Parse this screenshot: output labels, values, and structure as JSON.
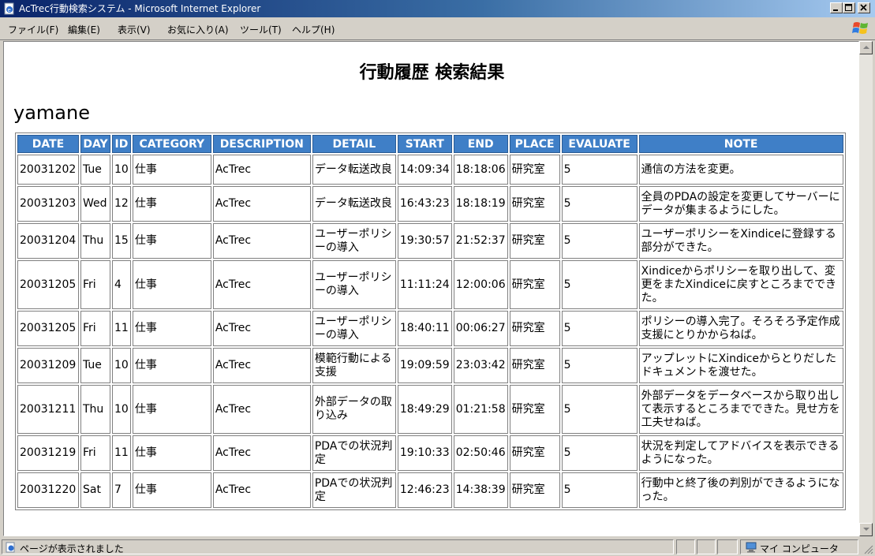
{
  "window": {
    "title": "AcTrec行動検索システム - Microsoft Internet Explorer"
  },
  "menu": {
    "items": [
      "ファイル(F)",
      "編集(E)",
      "表示(V)",
      "お気に入り(A)",
      "ツール(T)",
      "ヘルプ(H)"
    ]
  },
  "page": {
    "title": "行動履歴 検索結果",
    "user": "yamane"
  },
  "table": {
    "headers": [
      "DATE",
      "DAY",
      "ID",
      "CATEGORY",
      "DESCRIPTION",
      "DETAIL",
      "START",
      "END",
      "PLACE",
      "EVALUATE",
      "NOTE"
    ],
    "rows": [
      [
        "20031202",
        "Tue",
        "10",
        "仕事",
        "AcTrec",
        "データ転送改良",
        "14:09:34",
        "18:18:06",
        "研究室",
        "5",
        "通信の方法を変更。"
      ],
      [
        "20031203",
        "Wed",
        "12",
        "仕事",
        "AcTrec",
        "データ転送改良",
        "16:43:23",
        "18:18:19",
        "研究室",
        "5",
        "全員のPDAの設定を変更してサーバーにデータが集まるようにした。"
      ],
      [
        "20031204",
        "Thu",
        "15",
        "仕事",
        "AcTrec",
        "ユーザーポリシーの導入",
        "19:30:57",
        "21:52:37",
        "研究室",
        "5",
        "ユーザーポリシーをXindiceに登録する部分ができた。"
      ],
      [
        "20031205",
        "Fri",
        "4",
        "仕事",
        "AcTrec",
        "ユーザーポリシーの導入",
        "11:11:24",
        "12:00:06",
        "研究室",
        "5",
        "Xindiceからポリシーを取り出して、変更をまたXindiceに戻すところまでできた。"
      ],
      [
        "20031205",
        "Fri",
        "11",
        "仕事",
        "AcTrec",
        "ユーザーポリシーの導入",
        "18:40:11",
        "00:06:27",
        "研究室",
        "5",
        "ポリシーの導入完了。そろそろ予定作成支援にとりかからねば。"
      ],
      [
        "20031209",
        "Tue",
        "10",
        "仕事",
        "AcTrec",
        "模範行動による支援",
        "19:09:59",
        "23:03:42",
        "研究室",
        "5",
        "アップレットにXindiceからとりだしたドキュメントを渡せた。"
      ],
      [
        "20031211",
        "Thu",
        "10",
        "仕事",
        "AcTrec",
        "外部データの取り込み",
        "18:49:29",
        "01:21:58",
        "研究室",
        "5",
        "外部データをデータベースから取り出して表示するところまでできた。見せ方を工夫せねば。"
      ],
      [
        "20031219",
        "Fri",
        "11",
        "仕事",
        "AcTrec",
        "PDAでの状況判定",
        "19:10:33",
        "02:50:46",
        "研究室",
        "5",
        "状況を判定してアドバイスを表示できるようになった。"
      ],
      [
        "20031220",
        "Sat",
        "7",
        "仕事",
        "AcTrec",
        "PDAでの状況判定",
        "12:46:23",
        "14:38:39",
        "研究室",
        "5",
        "行動中と終了後の判別ができるようになった。"
      ]
    ]
  },
  "status": {
    "text": "ページが表示されました",
    "zone": "マイ コンピュータ"
  },
  "colors": {
    "header_bg": "#3f7fc7",
    "titlebar_start": "#0a246a",
    "titlebar_end": "#a6caf0"
  }
}
